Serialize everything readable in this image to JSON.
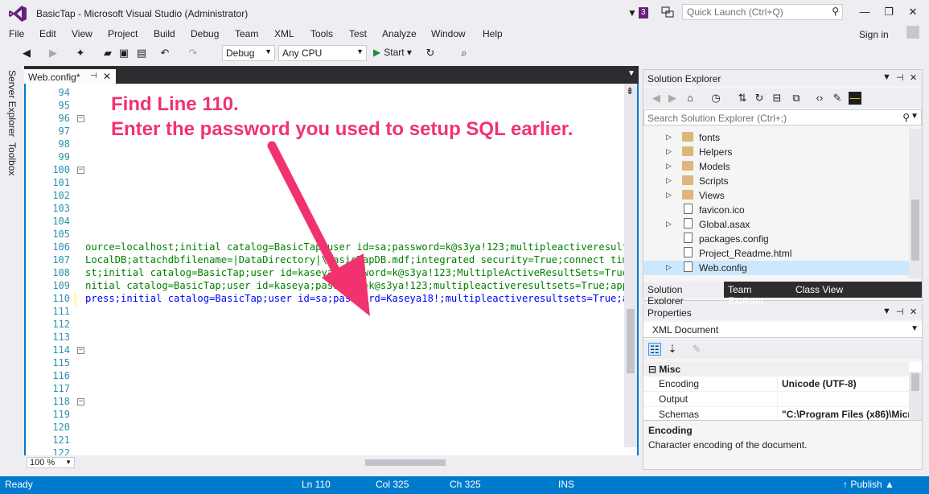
{
  "window": {
    "title": "BasicTap - Microsoft Visual Studio (Administrator)",
    "notification_count": "3",
    "quick_launch_placeholder": "Quick Launch (Ctrl+Q)",
    "sign_in": "Sign in"
  },
  "menu": [
    "File",
    "Edit",
    "View",
    "Project",
    "Build",
    "Debug",
    "Team",
    "XML",
    "Tools",
    "Test",
    "Analyze",
    "Window",
    "Help"
  ],
  "toolbar": {
    "configuration": "Debug",
    "platform": "Any CPU",
    "start_label": "Start"
  },
  "side_tabs": [
    "Server Explorer",
    "Toolbox"
  ],
  "editor": {
    "tab_label": "Web.config*",
    "zoom": "100 %",
    "line_numbers": [
      "94",
      "95",
      "96",
      "97",
      "98",
      "99",
      "100",
      "101",
      "102",
      "103",
      "104",
      "105",
      "106",
      "107",
      "108",
      "109",
      "110",
      "111",
      "112",
      "113",
      "114",
      "115",
      "116",
      "117",
      "118",
      "119",
      "120",
      "121",
      "122"
    ],
    "code_lines": [
      {
        "line": "106",
        "text": "ource=localhost;initial catalog=BasicTap;user id=sa;password=k@s3ya!123;multipleactiveresultsets=",
        "color": "green"
      },
      {
        "line": "107",
        "text": "LocalDB;attachdbfilename=|DataDirectory|\\BasicTapDB.mdf;integrated security=True;connect timeout",
        "color": "green"
      },
      {
        "line": "108",
        "text": "st;initial catalog=BasicTap;user id=kaseya;password=k@s3ya!123;MultipleActiveResultSets=True;App",
        "color": "green"
      },
      {
        "line": "109",
        "text": "nitial catalog=BasicTap;user id=kaseya;password=k@s3ya!123;multipleactiveresultsets=True;applica",
        "color": "green"
      },
      {
        "line": "110",
        "text": "press;initial catalog=BasicTap;user id=sa;password=Kaseya18!;multipleactiveresultsets=True;appli",
        "color": "blue"
      }
    ]
  },
  "annotation": {
    "line1": "Find Line 110.",
    "line2": "Enter the password you used to setup SQL earlier.",
    "color": "#f2326e"
  },
  "solution_explorer": {
    "title": "Solution Explorer",
    "search_placeholder": "Search Solution Explorer (Ctrl+;)",
    "items": [
      {
        "label": "fonts",
        "type": "folder",
        "expandable": true
      },
      {
        "label": "Helpers",
        "type": "folder",
        "expandable": true
      },
      {
        "label": "Models",
        "type": "folder",
        "expandable": true
      },
      {
        "label": "Scripts",
        "type": "folder",
        "expandable": true
      },
      {
        "label": "Views",
        "type": "folder",
        "expandable": true
      },
      {
        "label": "favicon.ico",
        "type": "file",
        "expandable": false
      },
      {
        "label": "Global.asax",
        "type": "file",
        "expandable": true
      },
      {
        "label": "packages.config",
        "type": "file",
        "expandable": false
      },
      {
        "label": "Project_Readme.html",
        "type": "file",
        "expandable": false
      },
      {
        "label": "Web.config",
        "type": "file",
        "expandable": true,
        "selected": true
      }
    ],
    "tabs": [
      "Solution Explorer",
      "Team Explorer",
      "Class View"
    ]
  },
  "properties": {
    "title": "Properties",
    "object": "XML Document",
    "category": "Misc",
    "rows": [
      {
        "key": "Encoding",
        "value": "Unicode (UTF-8)"
      },
      {
        "key": "Output",
        "value": ""
      },
      {
        "key": "Schemas",
        "value": "\"C:\\Program Files (x86)\\Micr"
      }
    ],
    "desc_title": "Encoding",
    "desc_text": "Character encoding of the document."
  },
  "status": {
    "ready": "Ready",
    "ln": "Ln 110",
    "col": "Col 325",
    "ch": "Ch 325",
    "ins": "INS",
    "publish": "Publish"
  },
  "colors": {
    "accent": "#007acc",
    "vs_purple": "#68217a"
  }
}
